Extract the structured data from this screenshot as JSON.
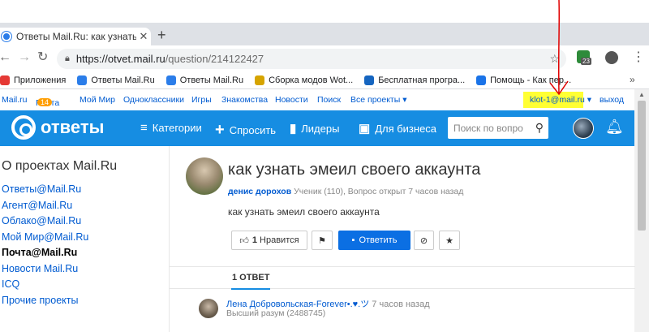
{
  "browser": {
    "tab_title": "Ответы Mail.Ru: как узнать эмеил",
    "url_host": "https://otvet.mail.ru",
    "url_path": "/question/214122427",
    "ext_badge": "23",
    "bookmarks": [
      {
        "label": "Приложения",
        "icon": "apps-grid-icon",
        "color": "#e53935"
      },
      {
        "label": "Ответы Mail.Ru",
        "icon": "otvety-icon",
        "color": "#2b7de9"
      },
      {
        "label": "Ответы Mail.Ru",
        "icon": "otvety-icon",
        "color": "#2b7de9"
      },
      {
        "label": "Сборка модов Wot...",
        "icon": "wot-icon",
        "color": "#d6a400"
      },
      {
        "label": "Бесплатная програ...",
        "icon": "malwarebytes-icon",
        "color": "#1565c0"
      },
      {
        "label": "Помощь - Как пер...",
        "icon": "help-icon",
        "color": "#1a73e8"
      }
    ]
  },
  "portal": {
    "links": [
      "Mail.ru",
      "Почта",
      "Мой Мир",
      "Одноклассники",
      "Игры",
      "Знакомства",
      "Новости",
      "Поиск",
      "Все проекты ▾"
    ],
    "mail_badge": "14",
    "user_email": "klot-1@mail.ru ▾",
    "logout": "выход"
  },
  "header": {
    "logo_text": "ответы",
    "nav": [
      {
        "label": "Категории",
        "icon": "≡"
      },
      {
        "label": "Спросить",
        "icon": "+"
      },
      {
        "label": "Лидеры",
        "icon": "▮"
      },
      {
        "label": "Для бизнеса",
        "icon": "▣"
      }
    ],
    "search_placeholder": "Поиск по вопро",
    "accent": "#168de2"
  },
  "sidebar": {
    "title": "О проектах Mail.Ru",
    "items": [
      {
        "label": "Ответы@Mail.Ru",
        "active": false
      },
      {
        "label": "Агент@Mail.Ru",
        "active": false
      },
      {
        "label": "Облако@Mail.Ru",
        "active": false
      },
      {
        "label": "Мой Мир@Mail.Ru",
        "active": false
      },
      {
        "label": "Почта@Mail.Ru",
        "active": true
      },
      {
        "label": "Новости Mail.Ru",
        "active": false
      },
      {
        "label": "ICQ",
        "active": false
      },
      {
        "label": "Прочие проекты",
        "active": false
      }
    ]
  },
  "question": {
    "title": "как узнать эмеил своего аккаунта",
    "author": "денис дорохов",
    "meta": " Ученик (110), Вопрос открыт 7 часов назад",
    "body": "как узнать эмеил своего аккаунта",
    "like_count": "1",
    "like_label": "Нравится",
    "answer_label": "Ответить"
  },
  "answers": {
    "tab_label": "1 ОТВЕТ",
    "first": {
      "author": "Лена Добровольская-Forever•.♥.ツ",
      "time": " 7 часов назад",
      "rank": "Высший разум (2488745)"
    }
  }
}
